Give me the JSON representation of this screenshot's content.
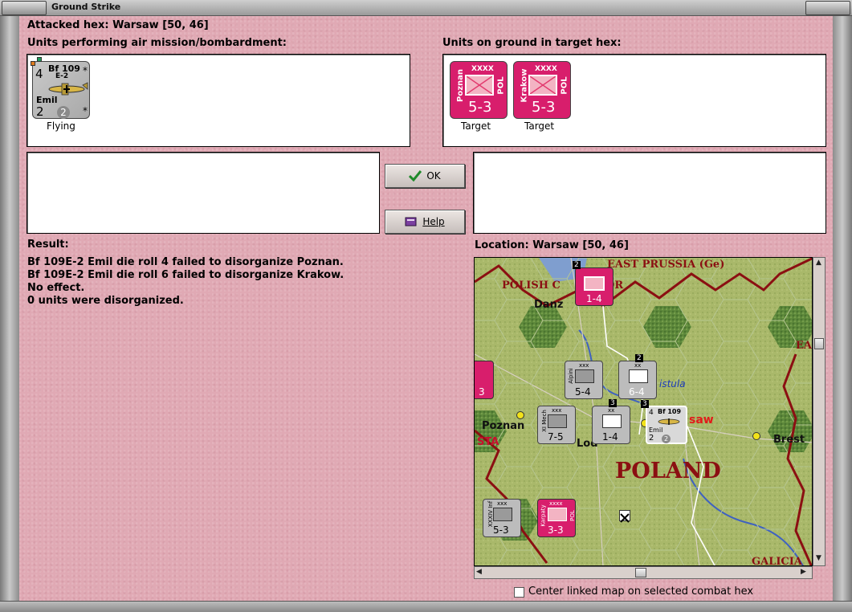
{
  "window": {
    "title": "Ground Strike"
  },
  "header": {
    "attacked_hex": "Attacked hex: Warsaw  [50, 46]"
  },
  "air_panel": {
    "label": "Units performing air mission/bombardment:",
    "units": [
      {
        "name": "Bf 109",
        "variant": "E-2",
        "nickname": "Emil",
        "strength": "4",
        "bottom_left": "2",
        "bottom_mid": "2",
        "star": "*",
        "status": "Flying"
      }
    ]
  },
  "ground_panel": {
    "label": "Units on ground in target hex:",
    "units": [
      {
        "name": "Poznan",
        "size": "XXXX",
        "nation": "POL",
        "value": "5-3",
        "status": "Target"
      },
      {
        "name": "Krakow",
        "size": "XXXX",
        "nation": "POL",
        "value": "5-3",
        "status": "Target"
      }
    ]
  },
  "buttons": {
    "ok": "OK",
    "help": "Help"
  },
  "result": {
    "label": "Result:",
    "lines": [
      "Bf 109E-2 Emil die roll 4 failed to disorganize Poznan.",
      "Bf 109E-2 Emil die roll 6 failed to disorganize Krakow.",
      "No effect.",
      "0 units were disorganized."
    ]
  },
  "location": {
    "label": "Location:  Warsaw  [50, 46]"
  },
  "map": {
    "labels": {
      "east_prussia": "EAST PRUSSIA (Ge)",
      "polish_corridor": "POLISH C",
      "corridor_tail": "OR",
      "danzig": "Danz",
      "vistula": "istula",
      "poznan": "Poznan",
      "sta": "STA",
      "lodz": "Lod",
      "warsaw": "saw",
      "brest": "Brest",
      "poland": "POLAND",
      "galicia": "GALICIA",
      "ea": "EA"
    },
    "counters": [
      {
        "label": "1-4",
        "kind": "pol",
        "stack": "2"
      },
      {
        "label": "5-4",
        "kind": "ger",
        "top": "xxx",
        "side": "Alpini"
      },
      {
        "label": "6-4",
        "kind": "ger",
        "top": "xx",
        "stack": "2"
      },
      {
        "label": "7-5",
        "kind": "ger",
        "top": "xxx",
        "side": "XI Mech"
      },
      {
        "label": "1-4",
        "kind": "ger",
        "top": "xx",
        "stack": "3"
      },
      {
        "label": "5-3",
        "kind": "ger",
        "top": "xxx",
        "side": "XXXIV Inf"
      },
      {
        "label": "3-3",
        "kind": "pol",
        "top": "xxxx",
        "side": "Karpaty",
        "nation": "POL"
      },
      {
        "label": "3",
        "kind": "pol-edge"
      }
    ],
    "air_counter": {
      "name": "Bf 109",
      "strength": "4",
      "bottom_left": "2",
      "bottom_mid": "2",
      "nickname": "Emil",
      "stack": "3"
    }
  },
  "footer": {
    "checkbox_label": "Center linked map on selected combat hex",
    "checked": false
  },
  "colors": {
    "background": "#e0a9b4",
    "polish_counter": "#d81e6c",
    "german_counter": "#bcbcbc"
  }
}
